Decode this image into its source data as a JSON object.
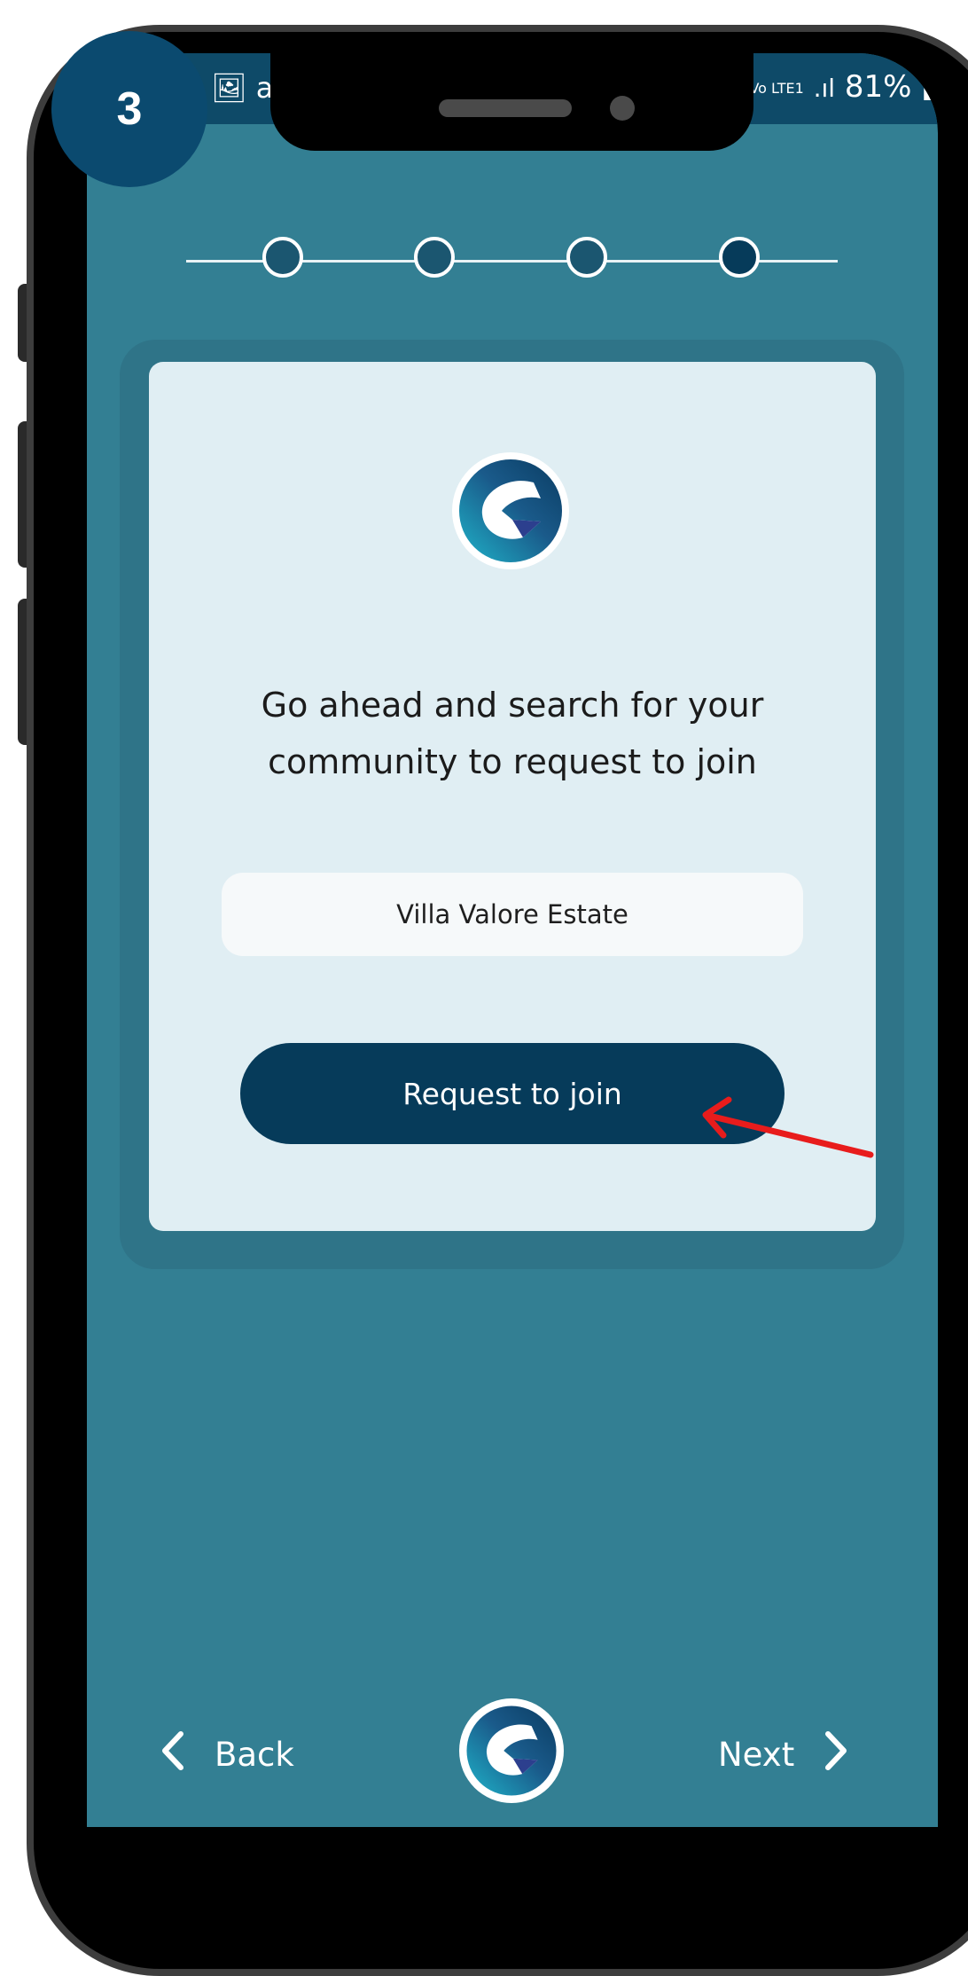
{
  "step_badge": "3",
  "status_bar": {
    "left_icons": "🖼 a",
    "right_text": "81%",
    "network": "Vo LTE1"
  },
  "stepper": {
    "total": 4,
    "current": 4,
    "dot_colors": [
      "#1b5670",
      "#1b5670",
      "#1b5670",
      "#063b5a"
    ]
  },
  "card": {
    "message": "Go ahead and search for your\ncommunity to request to join",
    "community_field": {
      "value": "Villa Valore Estate"
    },
    "request_button_label": "Request to join"
  },
  "nav": {
    "back_label": "Back",
    "next_label": "Next"
  },
  "colors": {
    "screen_bg": "#337f93",
    "card_bg": "#e0eef3",
    "primary": "#063b5a",
    "annotation_arrow": "#e81c1c"
  }
}
